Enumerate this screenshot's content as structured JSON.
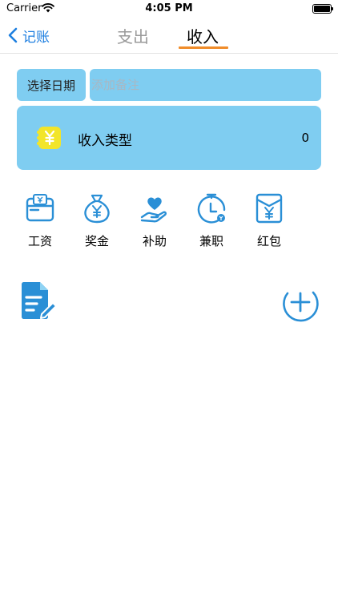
{
  "status_bar": {
    "carrier": "Carrier",
    "time": "4:05 PM"
  },
  "nav": {
    "back_label": "记账",
    "tabs": [
      {
        "label": "支出",
        "active": false
      },
      {
        "label": "收入",
        "active": true
      }
    ]
  },
  "form": {
    "date_button": "选择日期",
    "note_placeholder": "添加备注",
    "type_label": "收入类型",
    "amount": "0"
  },
  "categories": [
    {
      "label": "工资",
      "icon": "wallet-icon"
    },
    {
      "label": "奖金",
      "icon": "money-bag-icon"
    },
    {
      "label": "补助",
      "icon": "heart-hand-icon"
    },
    {
      "label": "兼职",
      "icon": "stopwatch-icon"
    },
    {
      "label": "红包",
      "icon": "red-envelope-icon"
    }
  ],
  "colors": {
    "accent_blue": "#1e7fe0",
    "icon_blue": "#2a8fd6",
    "panel_blue": "#7fcdf1",
    "tab_underline": "#f08c2a",
    "coin_yellow": "#f2e52a"
  }
}
